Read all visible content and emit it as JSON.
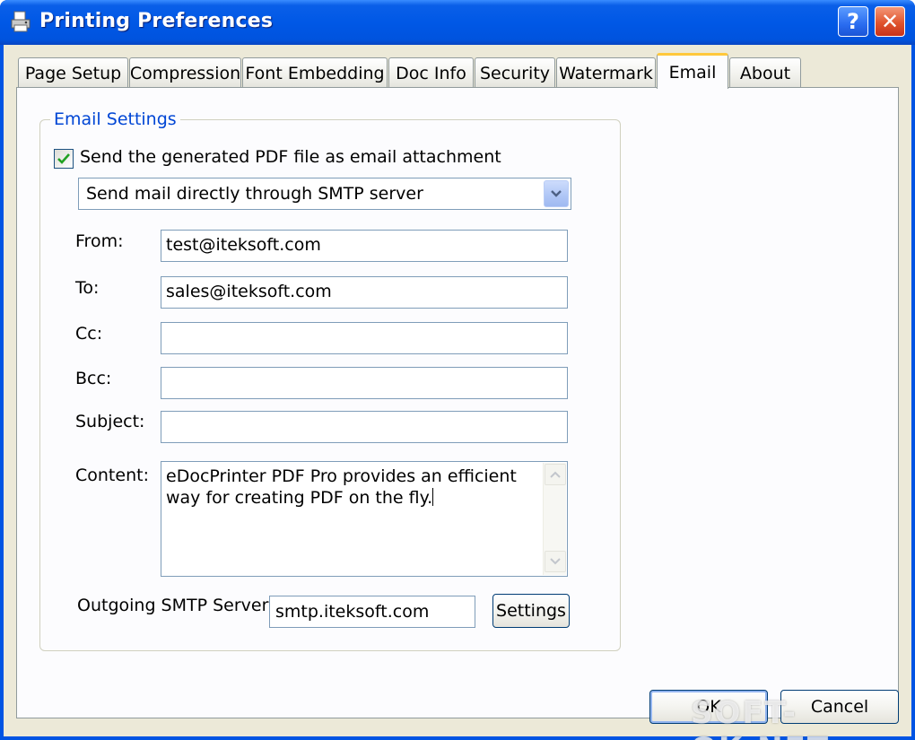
{
  "window": {
    "title": "Printing Preferences",
    "help_glyph": "?",
    "close_glyph": "✕"
  },
  "tabs": [
    {
      "label": "Page Setup"
    },
    {
      "label": "Compression"
    },
    {
      "label": "Font Embedding"
    },
    {
      "label": "Doc Info"
    },
    {
      "label": "Security"
    },
    {
      "label": "Watermark"
    },
    {
      "label": "Email",
      "active": true
    },
    {
      "label": "About"
    }
  ],
  "email": {
    "group_title": "Email Settings",
    "attach_checkbox_label": "Send the generated PDF file as email attachment",
    "attach_checked": true,
    "send_method": "Send mail directly through SMTP server",
    "from_label": "From:",
    "from_value": "test@iteksoft.com",
    "to_label": "To:",
    "to_value": "sales@iteksoft.com",
    "cc_label": "Cc:",
    "cc_value": "",
    "bcc_label": "Bcc:",
    "bcc_value": "",
    "subject_label": "Subject:",
    "subject_value": "",
    "content_label": "Content:",
    "content_value": "eDocPrinter PDF Pro provides an efficient way for creating PDF on the fly.",
    "smtp_label": "Outgoing SMTP Server",
    "smtp_value": "smtp.iteksoft.com",
    "settings_button": "Settings"
  },
  "footer": {
    "ok_label": "OK",
    "cancel_label": "Cancel"
  },
  "watermark_text": "SOFT-OK.NET",
  "colors": {
    "titlebar": "#0058e6",
    "dialog_bg": "#ece9d8",
    "group_title": "#0046d5",
    "active_tab_accent": "#ffc83c"
  }
}
